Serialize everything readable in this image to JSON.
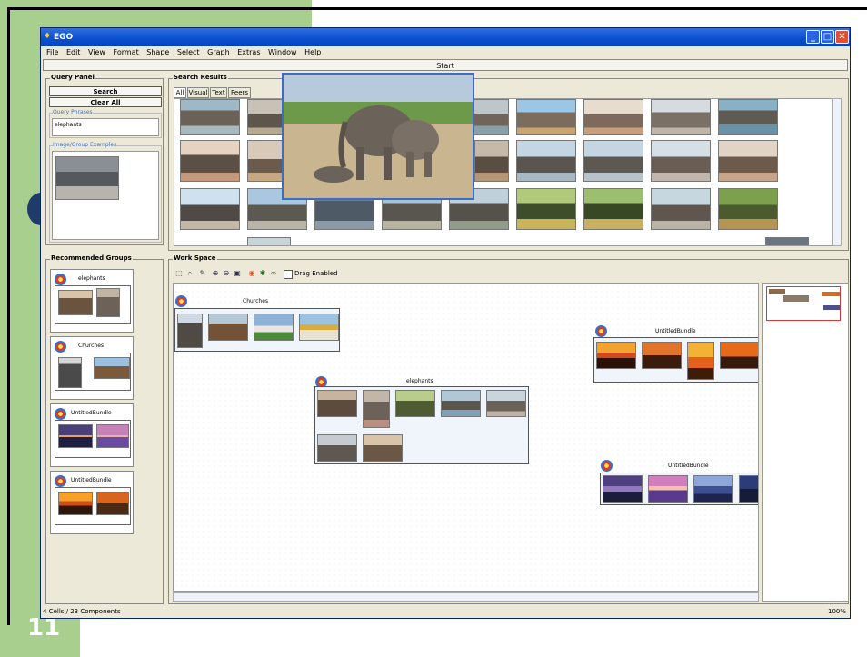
{
  "slide": {
    "number": "11"
  },
  "window": {
    "title": "EGO",
    "controls": {
      "minimize": "_",
      "maximize": "□",
      "close": "✕"
    }
  },
  "menu": [
    "File",
    "Edit",
    "View",
    "Format",
    "Shape",
    "Select",
    "Graph",
    "Extras",
    "Window",
    "Help"
  ],
  "start_label": "Start",
  "query_panel": {
    "title": "Query Panel",
    "search_label": "Search",
    "clear_label": "Clear All",
    "phrases_title": "Query Phrases",
    "phrase_value": "elephants",
    "examples_title": "Image/Group Examples"
  },
  "search_results": {
    "title": "Search Results",
    "tabs": [
      "All",
      "Visual",
      "Text",
      "Peers"
    ]
  },
  "recommended": {
    "title": "Recommended Groups",
    "groups": [
      "elephants",
      "Churches",
      "UntitledBundle",
      "UntitledBundle"
    ]
  },
  "workspace": {
    "title": "Work Space",
    "drag_label": "Drag Enabled",
    "bundles": [
      "Churches",
      "elephants",
      "UntitledBundle",
      "UntitledBundle"
    ]
  },
  "status": {
    "left": "4 Cells / 23 Components",
    "right": "100%"
  },
  "colors": {
    "titlebar": "#0a4fd0",
    "slide_green": "#a9cf8f",
    "chrome": "#ece9d8"
  }
}
